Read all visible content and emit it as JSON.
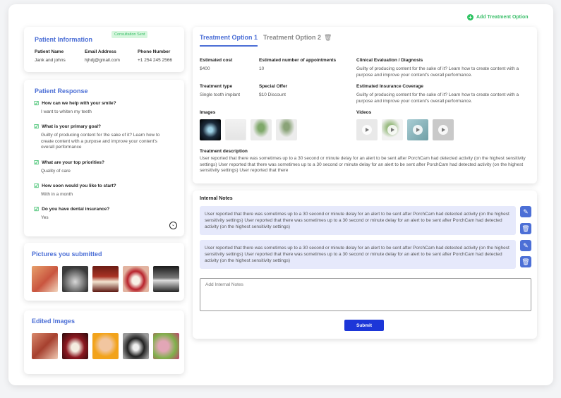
{
  "header": {
    "add_option_label": "Add Treatment Option"
  },
  "patient_info": {
    "title": "Patient Information",
    "badge": "Consultation Sent",
    "name_label": "Patient Name",
    "name": "Jank and johns",
    "email_label": "Email Address",
    "email": "hjhdj@gmail.com",
    "phone_label": "Phone Number",
    "phone": "+1 254 245 2566"
  },
  "patient_response": {
    "title": "Patient Response",
    "items": [
      {
        "q": "How can we help with your smile?",
        "a": "I want to whiten my teeth"
      },
      {
        "q": "What is your primary goal?",
        "a": "Guilty of producing content for the sake of it? Learn how to create content with a purpose and improve your content's overall performance"
      },
      {
        "q": "What are your top priorities?",
        "a": "Quality of care"
      },
      {
        "q": "How soon would you like to start?",
        "a": "With in a month"
      },
      {
        "q": "Do you have dental insurance?",
        "a": "Yes"
      }
    ]
  },
  "pictures": {
    "title": "Pictures you submitted"
  },
  "edited": {
    "title": "Edited Images"
  },
  "tabs": [
    {
      "label": "Treatment Option 1"
    },
    {
      "label": "Treatment Option 2"
    }
  ],
  "treatment": {
    "cost_label": "Estimated cost",
    "cost": "$400",
    "appts_label": "Estimated number of appointments",
    "appts": "10",
    "type_label": "Treatment type",
    "type": "Single tooth implant",
    "offer_label": "Special Offer",
    "offer": "$10 Discount",
    "clinical_label": "Clinical Evaluation / Diagnosis",
    "clinical": "Guilty of producing content for the sake of it? Learn how to create content with a purpose and improve your content's overall performance.",
    "insurance_label": "Estimated Insurance Coverage",
    "insurance": "Guilty of producing content for the sake of it? Learn how to create content with a purpose and improve your content's overall performance.",
    "images_label": "Images",
    "videos_label": "Videos",
    "desc_label": "Treatment description",
    "desc": "User reported that there was sometimes up to a 30 second or minute delay for an alert to be sent after PorchCam had detected activity (on the highest sensitivity settings) User reported that there was sometimes up to a 30 second or minute delay for an alert to be sent after PorchCam had detected activity (on the highest sensitivity settings) User reported that there"
  },
  "notes": {
    "title": "Internal Notes",
    "items": [
      "User reported that there was sometimes up to a 30 second or minute delay for an alert to be sent after PorchCam had detected activity (on the highest sensitivity settings) User reported that there was sometimes up to a 30 second or minute delay for an alert to be sent after PorchCam had detected activity (on the highest sensitivity settings)",
      "User reported that there was sometimes up to a 30 second or minute delay for an alert to be sent after PorchCam had detected activity (on the highest sensitivity settings) User reported that there was sometimes up to a 30 second or minute delay for an alert to be sent after PorchCam had detected activity (on the highest sensitivity settings)"
    ],
    "placeholder": "Add Internal Notes",
    "submit": "Submit"
  },
  "icons": {
    "add": "plus-circle-icon",
    "delete_tab": "trash-icon",
    "edit": "pencil-icon",
    "delete": "trash-icon",
    "check": "check-square-icon",
    "expand": "chevron-down-circle-icon",
    "play": "play-icon"
  },
  "colors": {
    "accent": "#4c6fd6",
    "success": "#3bbf6a",
    "submit": "#1c36d8",
    "note_bg": "#e6e9fb"
  }
}
